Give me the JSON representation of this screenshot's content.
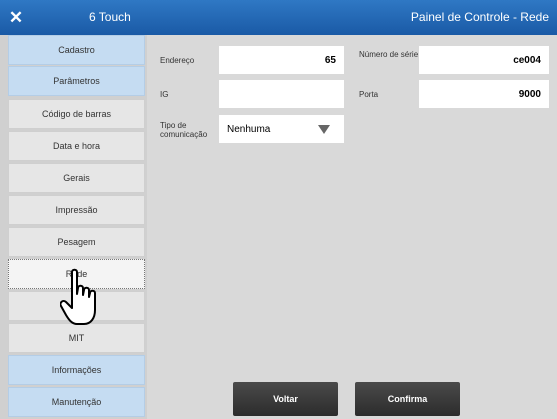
{
  "titlebar": {
    "close_glyph": "✕",
    "app_title": "6 Touch",
    "panel_title": "Painel de Controle - Rede"
  },
  "sidebar": {
    "items": [
      {
        "label": "Cadastro",
        "style": "blue"
      },
      {
        "label": "Parâmetros",
        "style": "blue"
      },
      {
        "label": "Código de barras",
        "style": "gray"
      },
      {
        "label": "Data e hora",
        "style": "gray"
      },
      {
        "label": "Gerais",
        "style": "gray"
      },
      {
        "label": "Impressão",
        "style": "gray"
      },
      {
        "label": "Pesagem",
        "style": "gray"
      },
      {
        "label": "Rede",
        "style": "active"
      },
      {
        "label": "",
        "style": "gray"
      },
      {
        "label": "MIT",
        "style": "gray"
      },
      {
        "label": "Informações",
        "style": "blue"
      },
      {
        "label": "Manutenção",
        "style": "blue"
      }
    ]
  },
  "form": {
    "endereco_label": "Endereço",
    "endereco_value": "65",
    "numero_serie_label": "Número de série",
    "numero_serie_value": "ce004",
    "ig_label": "IG",
    "ig_value": "",
    "porta_label": "Porta",
    "porta_value": "9000",
    "tipo_label": "Tipo de comunicação",
    "tipo_value": "Nenhuma"
  },
  "buttons": {
    "voltar": "Voltar",
    "confirma": "Confirma"
  },
  "colors": {
    "titlebar": "#1f63b0",
    "sidebar_blue": "#c5dcf2",
    "button_dark": "#333333"
  }
}
